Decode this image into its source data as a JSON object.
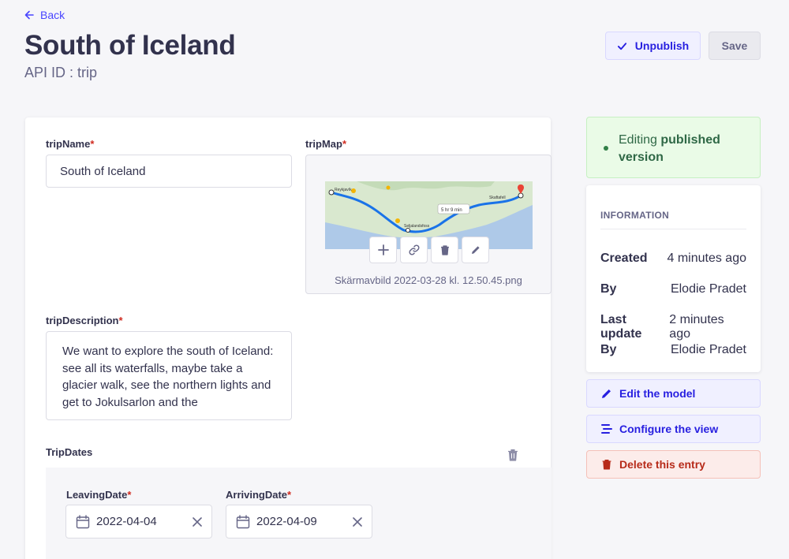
{
  "nav": {
    "back_label": "Back"
  },
  "header": {
    "title": "South of Iceland",
    "api_id": "API ID : trip"
  },
  "actions": {
    "unpublish_label": "Unpublish",
    "save_label": "Save"
  },
  "fields": {
    "tripName": {
      "label": "tripName",
      "required_mark": "*",
      "value": "South of Iceland"
    },
    "tripMap": {
      "label": "tripMap",
      "required_mark": "*",
      "filename": "Skärmavbild 2022-03-28 kl. 12.50.45.png",
      "map_labels": [
        "Reykjavík",
        "Seljalandsfoss",
        "5 hr 9 min",
        "Skaftafell"
      ]
    },
    "tripDescription": {
      "label": "tripDescription",
      "required_mark": "*",
      "value": "We want to explore the south of Iceland: see all its waterfalls, maybe take a glacier walk, see the northern lights and get to Jokulsarlon and the"
    },
    "tripDates": {
      "label": "TripDates",
      "leaving": {
        "label": "LeavingDate",
        "required_mark": "*",
        "value": "2022-04-04"
      },
      "arriving": {
        "label": "ArrivingDate",
        "required_mark": "*",
        "value": "2022-04-09"
      }
    }
  },
  "sidebar": {
    "status": {
      "prefix": "Editing ",
      "bold": "published version"
    },
    "info": {
      "title": "INFORMATION",
      "rows": [
        {
          "key": "Created",
          "value": "4 minutes ago"
        },
        {
          "key": "By",
          "value": "Elodie Pradet"
        },
        {
          "key": "Last update",
          "value": "2 minutes ago"
        },
        {
          "key": "By",
          "value": "Elodie Pradet"
        }
      ]
    },
    "edit_model_label": "Edit the model",
    "configure_view_label": "Configure the view",
    "delete_entry_label": "Delete this entry"
  },
  "colors": {
    "primary": "#4945ff",
    "success_bg": "#eafbe7",
    "danger": "#d02b20"
  }
}
